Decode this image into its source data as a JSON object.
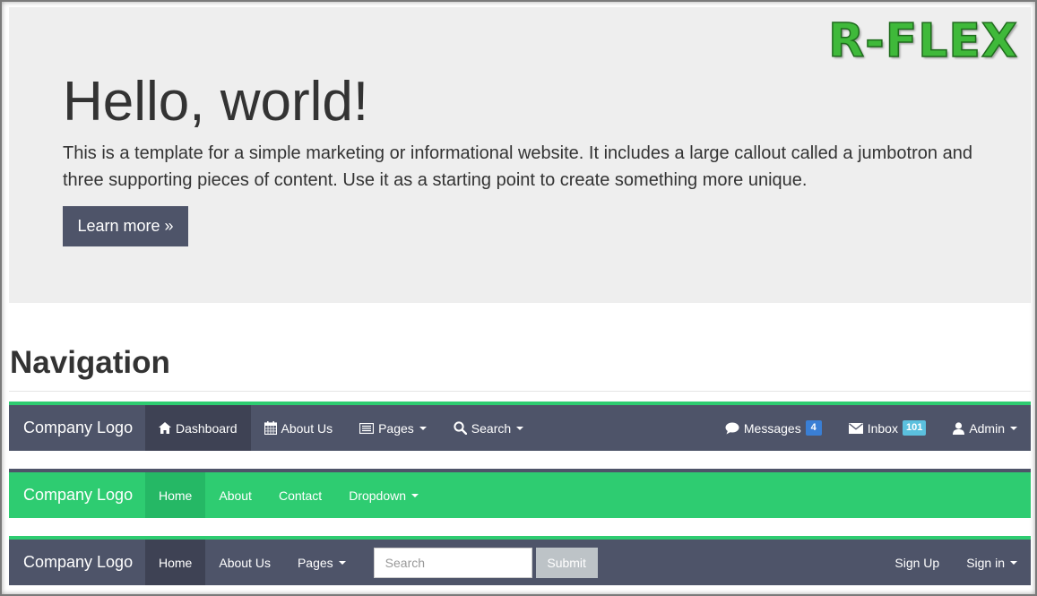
{
  "watermark": {
    "text": "R-FLEX",
    "color": "#3fb93a"
  },
  "jumbotron": {
    "title": "Hello, world!",
    "text": "This is a template for a simple marketing or informational website. It includes a large callout called a jumbotron and three supporting pieces of content. Use it as a starting point to create something more unique.",
    "button_label": "Learn more »"
  },
  "section": {
    "title": "Navigation"
  },
  "colors": {
    "dark": "#4e5469",
    "green": "#2ecc71",
    "light_bg": "#eeeeee"
  },
  "navbar1": {
    "brand": "Company Logo",
    "items": [
      {
        "label": "Dashboard",
        "icon": "home-icon"
      },
      {
        "label": "About Us",
        "icon": "calendar-icon"
      },
      {
        "label": "Pages",
        "icon": "list-icon"
      },
      {
        "label": "Search",
        "icon": "search-icon"
      }
    ],
    "right": [
      {
        "label": "Messages",
        "icon": "comment-icon",
        "badge": "4"
      },
      {
        "label": "Inbox",
        "icon": "envelope-icon",
        "badge": "101"
      },
      {
        "label": "Admin",
        "icon": "user-icon"
      }
    ]
  },
  "navbar2": {
    "brand": "Company Logo",
    "items": [
      {
        "label": "Home"
      },
      {
        "label": "About"
      },
      {
        "label": "Contact"
      },
      {
        "label": "Dropdown"
      }
    ]
  },
  "navbar3": {
    "brand": "Company Logo",
    "items": [
      {
        "label": "Home"
      },
      {
        "label": "About Us"
      },
      {
        "label": "Pages"
      }
    ],
    "search_placeholder": "Search",
    "submit_label": "Submit",
    "right": [
      {
        "label": "Sign Up"
      },
      {
        "label": "Sign in"
      }
    ]
  }
}
